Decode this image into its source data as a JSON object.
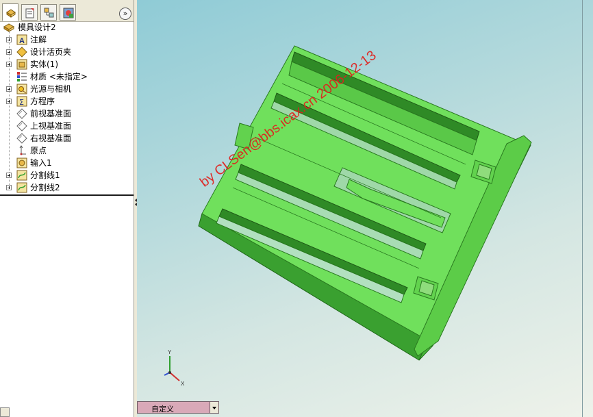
{
  "tabs": [
    {
      "icon": "feature-manager-icon",
      "active": true
    },
    {
      "icon": "property-manager-icon",
      "active": false
    },
    {
      "icon": "configuration-manager-icon",
      "active": false
    },
    {
      "icon": "display-manager-icon",
      "active": false
    }
  ],
  "collapse_button": "»",
  "tree": {
    "root": {
      "label": "模具设计2",
      "icon": "part-icon"
    },
    "items": [
      {
        "label": "注解",
        "icon": "annotations-icon",
        "expandable": true
      },
      {
        "label": "设计活页夹",
        "icon": "design-binder-icon",
        "expandable": true
      },
      {
        "label": "实体(1)",
        "icon": "solid-bodies-icon",
        "expandable": true
      },
      {
        "label": "材质 <未指定>",
        "icon": "material-icon",
        "expandable": false
      },
      {
        "label": "光源与相机",
        "icon": "lights-cameras-icon",
        "expandable": true
      },
      {
        "label": "方程序",
        "icon": "equations-icon",
        "expandable": true
      },
      {
        "label": "前视基准面",
        "icon": "plane-icon",
        "expandable": false
      },
      {
        "label": "上视基准面",
        "icon": "plane-icon",
        "expandable": false
      },
      {
        "label": "右视基准面",
        "icon": "plane-icon",
        "expandable": false
      },
      {
        "label": "原点",
        "icon": "origin-icon",
        "expandable": false
      },
      {
        "label": "输入1",
        "icon": "imported-feature-icon",
        "expandable": false
      },
      {
        "label": "分割线1",
        "icon": "split-line-icon",
        "expandable": true
      },
      {
        "label": "分割线2",
        "icon": "split-line-icon",
        "expandable": true
      }
    ]
  },
  "viewport": {
    "watermark": "by CLSen@bbs.icax.cn 2006-12-13",
    "watermark_color": "#e0201c",
    "model_color": "#66dd55",
    "triad": {
      "y_label": "Y",
      "x_label": "X"
    }
  },
  "configuration": {
    "label": "自定义"
  }
}
